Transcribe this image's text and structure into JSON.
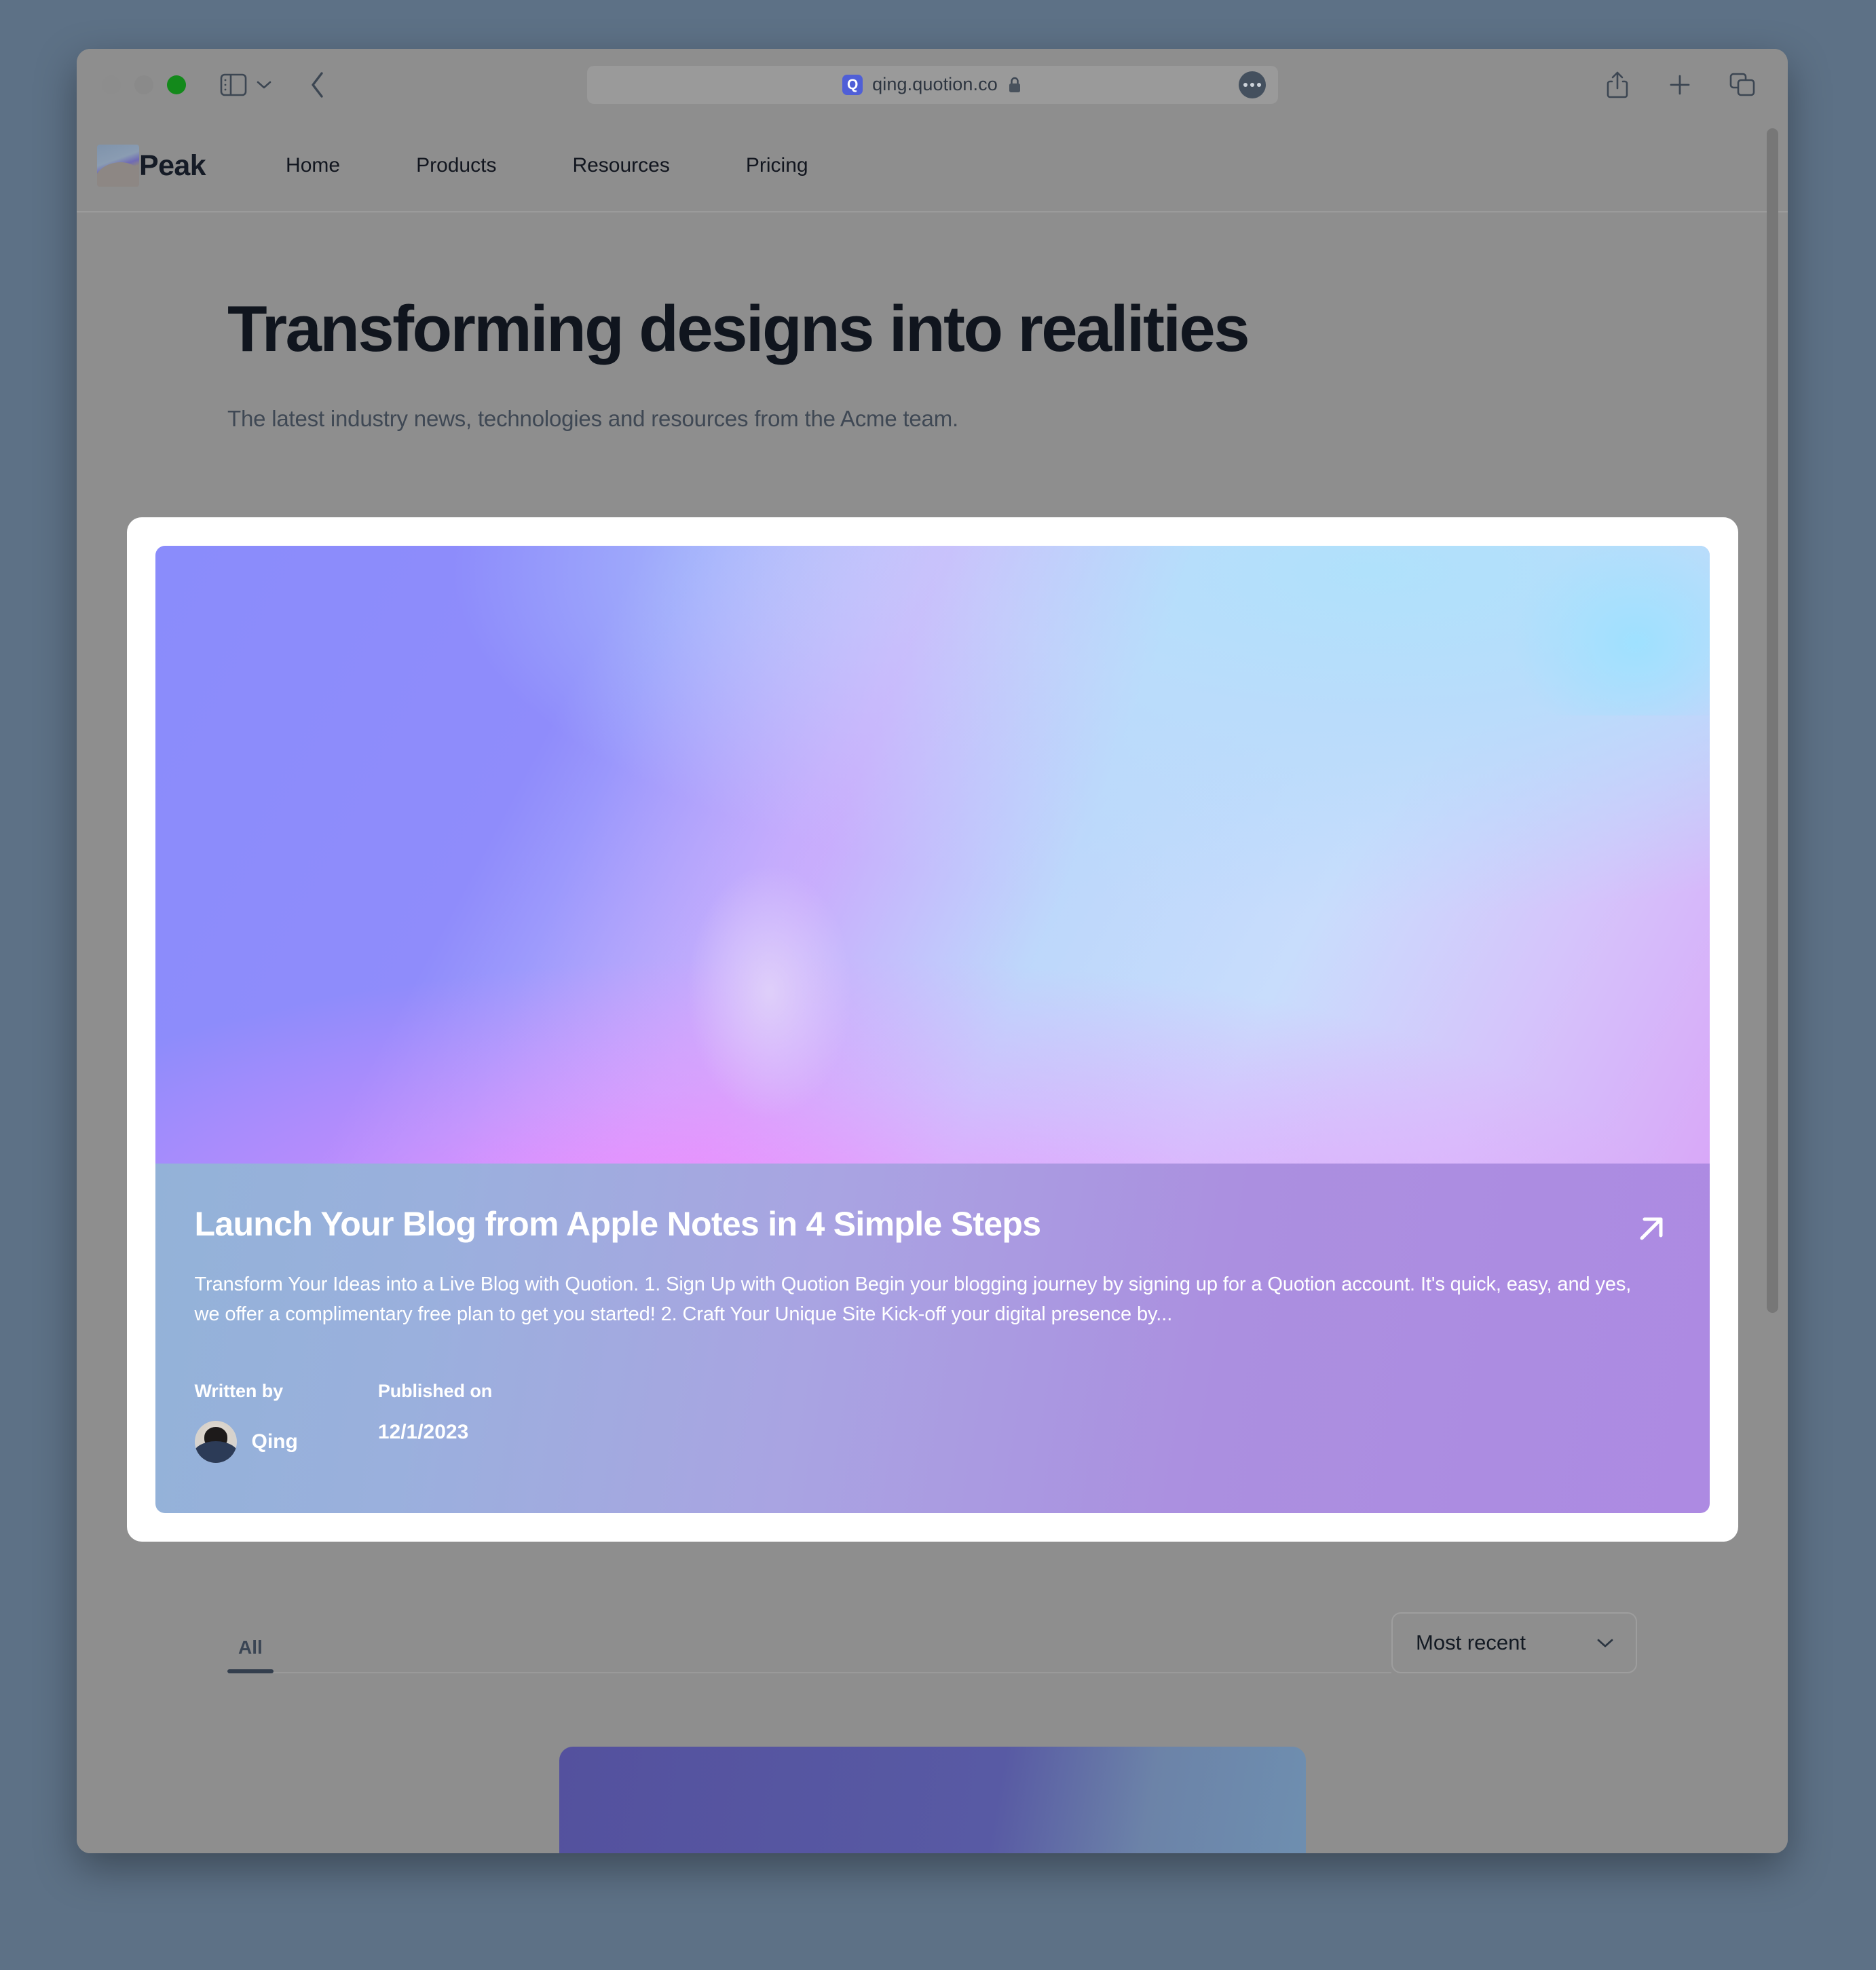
{
  "browser": {
    "traffic_lights": [
      "close",
      "minimize",
      "zoom"
    ],
    "sidebar_toggle": "sidebar-toggle",
    "sidebar_chevron": "chevron-down",
    "back_button": "back",
    "address": {
      "favicon_letter": "Q",
      "url": "qing.quotion.co",
      "secure_icon": "lock",
      "page_menu": "more-options"
    },
    "right_actions": [
      "share",
      "new-tab",
      "tab-overview"
    ]
  },
  "site": {
    "brand": {
      "name": "Peak",
      "logo": "mountain-logo"
    },
    "nav": [
      {
        "label": "Home"
      },
      {
        "label": "Products"
      },
      {
        "label": "Resources"
      },
      {
        "label": "Pricing"
      }
    ]
  },
  "hero": {
    "title": "Transforming designs into realities",
    "subtitle": "The latest industry news, technologies and resources from the Acme team."
  },
  "featured_post": {
    "headline": "Launch Your Blog from Apple Notes in 4 Simple Steps",
    "excerpt": "Transform Your Ideas into a Live Blog with Quotion. 1. Sign Up with Quotion Begin your blogging journey by signing up for a Quotion account. It's quick, easy, and yes, we offer a complimentary free plan to get you started! 2. Craft Your Unique Site Kick-off your digital presence by...",
    "open_link_icon": "arrow-up-right",
    "written_by_label": "Written by",
    "author_name": "Qing",
    "published_on_label": "Published on",
    "published_date": "12/1/2023",
    "image_colors": {
      "purple": "#8a8cfb",
      "light_blue": "#b9dcfb",
      "magenta": "#e08cf8",
      "lavender": "#d5c4fb"
    },
    "body_gradient_start": "#93b2d8",
    "body_gradient_end": "#ad8ae2"
  },
  "filters": {
    "tabs": [
      {
        "label": "All",
        "active": true
      }
    ],
    "sort": {
      "value": "Most recent",
      "chevron": "chevron-down"
    }
  },
  "colors": {
    "page_background": "#8e8e8e",
    "desktop_background": "#5d7186",
    "text_primary": "#10151e",
    "text_secondary": "#3f4854",
    "card_surface": "#ffffff"
  }
}
